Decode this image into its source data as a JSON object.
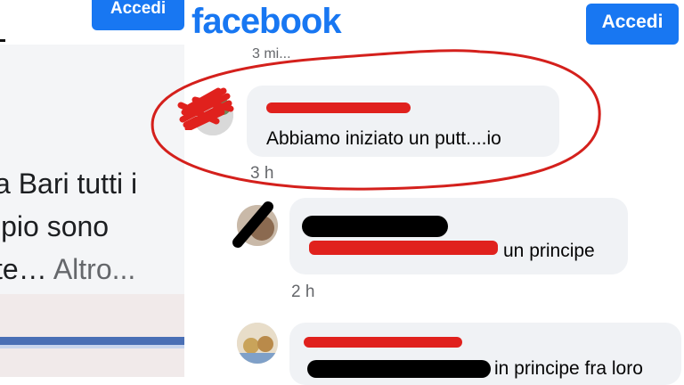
{
  "colors": {
    "brand": "#1877f2",
    "redaction_red": "#e0211d",
    "bubble": "#f0f2f5",
    "muted": "#65676b"
  },
  "left": {
    "login_label": "Accedi",
    "post_text": {
      "line1": "a Bari tutti i",
      "line2": "ipio sono",
      "line3": "te…",
      "more": "Altro..."
    }
  },
  "header": {
    "logo": "facebook",
    "login_label": "Accedi"
  },
  "thread": {
    "top_time": "3 mi...",
    "comments": [
      {
        "text": "Abbiamo iniziato un putt....io",
        "time": "3 h"
      },
      {
        "text": "un principe",
        "time": "2 h"
      },
      {
        "text": "in principe fra loro",
        "time": ""
      }
    ]
  }
}
